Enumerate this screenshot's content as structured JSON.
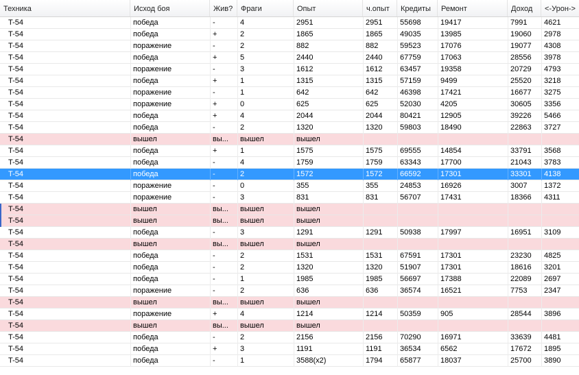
{
  "columns": [
    "Техника",
    "Исход боя",
    "Жив?",
    "Фраги",
    "Опыт",
    "ч.опыт",
    "Кредиты",
    "Ремонт",
    "Доход",
    "<-Урон->"
  ],
  "rows": [
    {
      "v": [
        "T-54",
        "победа",
        "-",
        "4",
        "2951",
        "2951",
        "55698",
        "19417",
        "7991",
        "4621"
      ],
      "state": "normal"
    },
    {
      "v": [
        "T-54",
        "победа",
        "+",
        "2",
        "1865",
        "1865",
        "49035",
        "13985",
        "19060",
        "2978"
      ],
      "state": "normal"
    },
    {
      "v": [
        "T-54",
        "поражение",
        "-",
        "2",
        "882",
        "882",
        "59523",
        "17076",
        "19077",
        "4308"
      ],
      "state": "normal"
    },
    {
      "v": [
        "T-54",
        "победа",
        "+",
        "5",
        "2440",
        "2440",
        "67759",
        "17063",
        "28556",
        "3978"
      ],
      "state": "normal"
    },
    {
      "v": [
        "T-54",
        "поражение",
        "-",
        "3",
        "1612",
        "1612",
        "63457",
        "19358",
        "20729",
        "4793"
      ],
      "state": "normal"
    },
    {
      "v": [
        "T-54",
        "победа",
        "+",
        "1",
        "1315",
        "1315",
        "57159",
        "9499",
        "25520",
        "3218"
      ],
      "state": "normal"
    },
    {
      "v": [
        "T-54",
        "поражение",
        "-",
        "1",
        "642",
        "642",
        "46398",
        "17421",
        "16677",
        "3275"
      ],
      "state": "normal"
    },
    {
      "v": [
        "T-54",
        "поражение",
        "+",
        "0",
        "625",
        "625",
        "52030",
        "4205",
        "30605",
        "3356"
      ],
      "state": "normal"
    },
    {
      "v": [
        "T-54",
        "победа",
        "+",
        "4",
        "2044",
        "2044",
        "80421",
        "12905",
        "39226",
        "5466"
      ],
      "state": "normal"
    },
    {
      "v": [
        "T-54",
        "победа",
        "-",
        "2",
        "1320",
        "1320",
        "59803",
        "18490",
        "22863",
        "3727"
      ],
      "state": "normal"
    },
    {
      "v": [
        "T-54",
        "вышел",
        "вы...",
        "вышел",
        "вышел",
        "",
        "",
        "",
        "",
        ""
      ],
      "state": "exit"
    },
    {
      "v": [
        "T-54",
        "победа",
        "+",
        "1",
        "1575",
        "1575",
        "69555",
        "14854",
        "33791",
        "3568"
      ],
      "state": "normal"
    },
    {
      "v": [
        "T-54",
        "победа",
        "-",
        "4",
        "1759",
        "1759",
        "63343",
        "17700",
        "21043",
        "3783"
      ],
      "state": "normal"
    },
    {
      "v": [
        "T-54",
        "победа",
        "-",
        "2",
        "1572",
        "1572",
        "66592",
        "17301",
        "33301",
        "4138"
      ],
      "state": "selected"
    },
    {
      "v": [
        "T-54",
        "поражение",
        "-",
        "0",
        "355",
        "355",
        "24853",
        "16926",
        "3007",
        "1372"
      ],
      "state": "normal"
    },
    {
      "v": [
        "T-54",
        "поражение",
        "-",
        "3",
        "831",
        "831",
        "56707",
        "17431",
        "18366",
        "4311"
      ],
      "state": "normal"
    },
    {
      "v": [
        "T-54",
        "вышел",
        "вы...",
        "вышел",
        "вышел",
        "",
        "",
        "",
        "",
        ""
      ],
      "state": "exit",
      "marker": true
    },
    {
      "v": [
        "T-54",
        "вышел",
        "вы...",
        "вышел",
        "вышел",
        "",
        "",
        "",
        "",
        ""
      ],
      "state": "exit",
      "marker": true
    },
    {
      "v": [
        "T-54",
        "победа",
        "-",
        "3",
        "1291",
        "1291",
        "50938",
        "17997",
        "16951",
        "3109"
      ],
      "state": "normal"
    },
    {
      "v": [
        "T-54",
        "вышел",
        "вы...",
        "вышел",
        "вышел",
        "",
        "",
        "",
        "",
        ""
      ],
      "state": "exit"
    },
    {
      "v": [
        "T-54",
        "победа",
        "-",
        "2",
        "1531",
        "1531",
        "67591",
        "17301",
        "23230",
        "4825"
      ],
      "state": "normal"
    },
    {
      "v": [
        "T-54",
        "победа",
        "-",
        "2",
        "1320",
        "1320",
        "51907",
        "17301",
        "18616",
        "3201"
      ],
      "state": "normal"
    },
    {
      "v": [
        "T-54",
        "победа",
        "-",
        "1",
        "1985",
        "1985",
        "56697",
        "17388",
        "22089",
        "2697"
      ],
      "state": "normal"
    },
    {
      "v": [
        "T-54",
        "поражение",
        "-",
        "2",
        "636",
        "636",
        "36574",
        "16521",
        "7753",
        "2347"
      ],
      "state": "normal"
    },
    {
      "v": [
        "T-54",
        "вышел",
        "вы...",
        "вышел",
        "вышел",
        "",
        "",
        "",
        "",
        ""
      ],
      "state": "exit"
    },
    {
      "v": [
        "T-54",
        "поражение",
        "+",
        "4",
        "1214",
        "1214",
        "50359",
        "905",
        "28544",
        "3896"
      ],
      "state": "normal"
    },
    {
      "v": [
        "T-54",
        "вышел",
        "вы...",
        "вышел",
        "вышел",
        "",
        "",
        "",
        "",
        ""
      ],
      "state": "exit"
    },
    {
      "v": [
        "T-54",
        "победа",
        "-",
        "2",
        "2156",
        "2156",
        "70290",
        "16971",
        "33639",
        "4481"
      ],
      "state": "normal"
    },
    {
      "v": [
        "T-54",
        "победа",
        "+",
        "3",
        "1191",
        "1191",
        "36534",
        "6562",
        "17672",
        "1895"
      ],
      "state": "normal"
    },
    {
      "v": [
        "T-54",
        "победа",
        "-",
        "1",
        "3588(x2)",
        "1794",
        "65877",
        "18037",
        "25700",
        "3890"
      ],
      "state": "normal"
    }
  ],
  "colors": {
    "selected": "#3399ff",
    "exited": "#fadadd",
    "marker": "#3a66c8"
  }
}
